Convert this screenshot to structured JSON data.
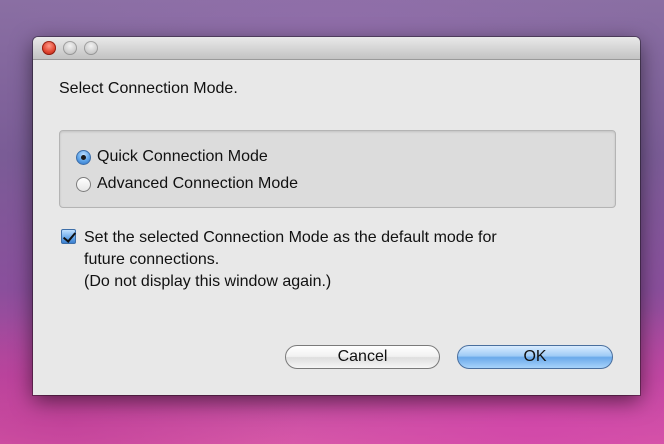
{
  "dialog": {
    "prompt": "Select Connection Mode.",
    "mode_options": [
      {
        "label": "Quick Connection Mode",
        "selected": true
      },
      {
        "label": "Advanced Connection Mode",
        "selected": false
      }
    ],
    "default_checkbox": {
      "checked": true,
      "lines": [
        "Set the selected Connection Mode as the default mode for",
        "future connections.",
        "(Do not display this window again.)"
      ]
    },
    "buttons": {
      "cancel_label": "Cancel",
      "ok_label": "OK"
    }
  },
  "colors": {
    "window_bg": "#e8e8e8",
    "accent_blue": "#6aa9ea",
    "close_red": "#e0442f"
  }
}
